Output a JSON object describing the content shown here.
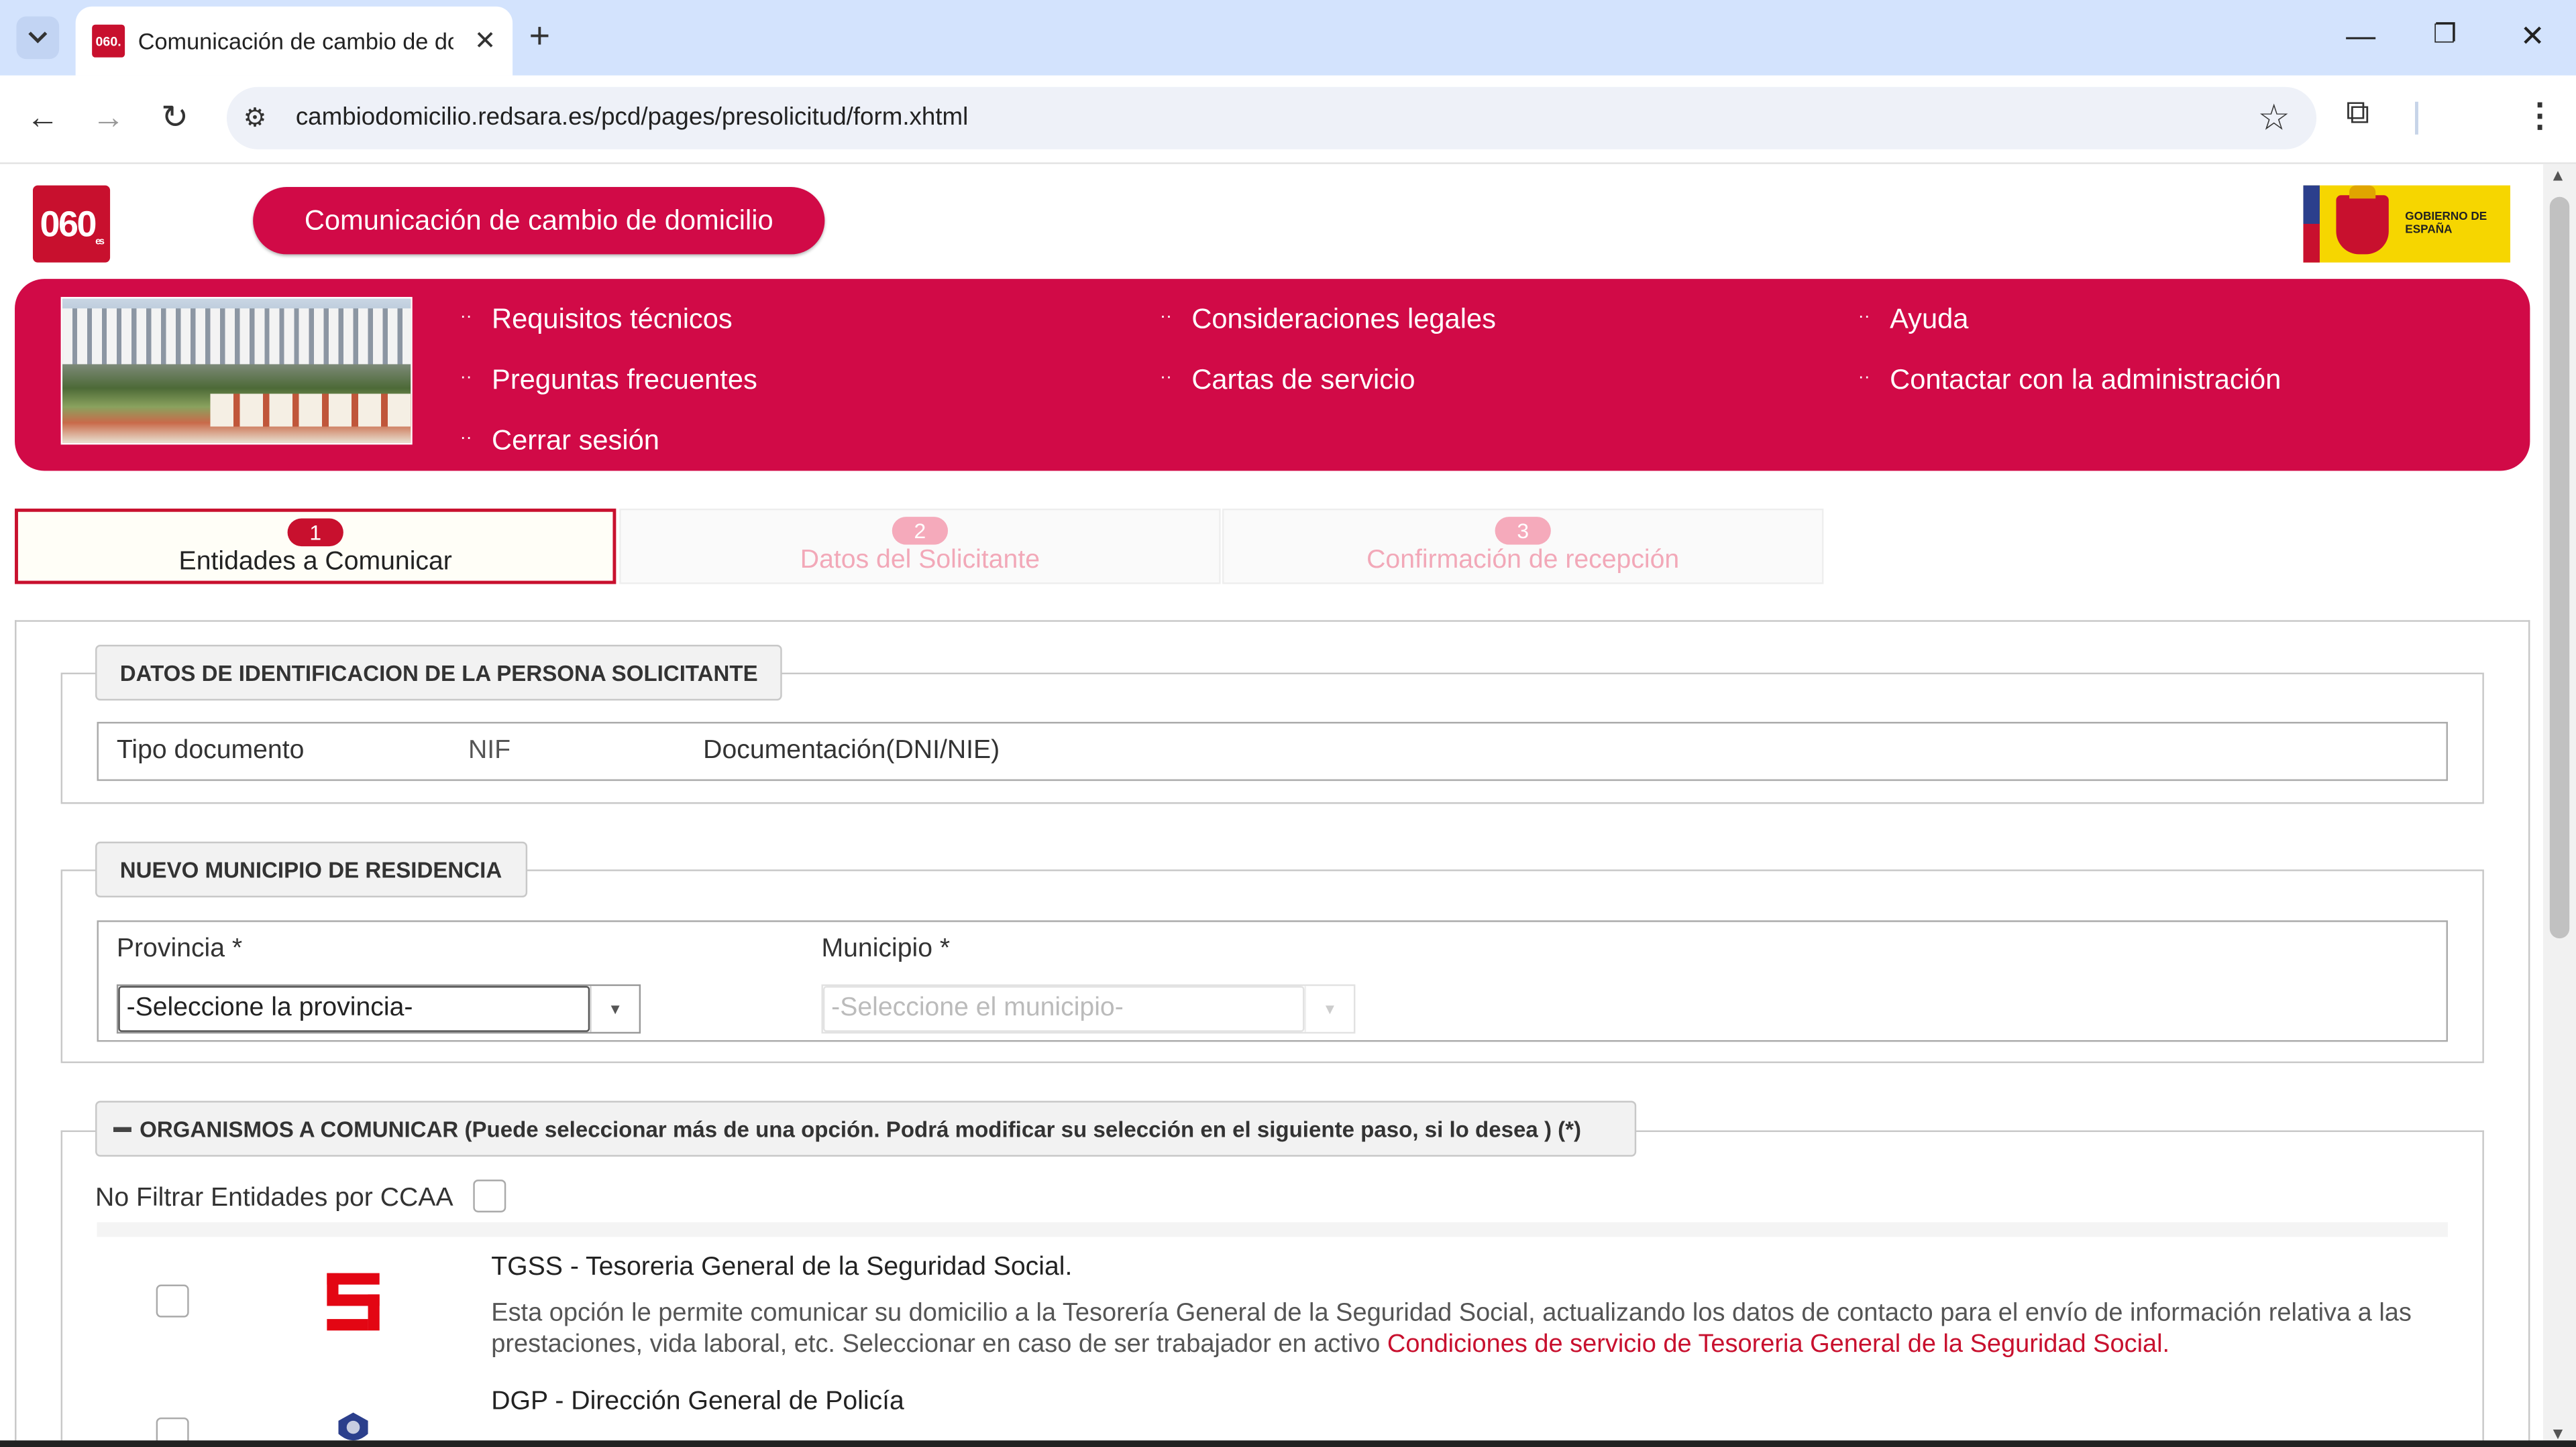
{
  "browser": {
    "tab_title": "Comunicación de cambio de do",
    "favicon_label": "060.",
    "url": "cambiodomicilio.redsara.es/pcd/pages/presolicitud/form.xhtml"
  },
  "header": {
    "logo": "060",
    "logo_suffix": "es",
    "title": "Comunicación de cambio de domicilio",
    "gov_logo_text": "GOBIERNO DE ESPAÑA"
  },
  "nav": {
    "items": [
      {
        "label": "Requisitos técnicos"
      },
      {
        "label": "Consideraciones legales"
      },
      {
        "label": "Ayuda"
      },
      {
        "label": "Preguntas frecuentes"
      },
      {
        "label": "Cartas de servicio"
      },
      {
        "label": "Contactar con la administración"
      },
      {
        "label": "Cerrar sesión"
      }
    ]
  },
  "steps": [
    {
      "num": "1",
      "label": "Entidades a Comunicar",
      "active": true
    },
    {
      "num": "2",
      "label": "Datos del Solicitante",
      "active": false
    },
    {
      "num": "3",
      "label": "Confirmación de recepción",
      "active": false
    }
  ],
  "identificacion": {
    "legend": "DATOS DE IDENTIFICACION DE LA PERSONA SOLICITANTE",
    "tipo_label": "Tipo documento",
    "tipo_value": "NIF",
    "doc_label": "Documentación(DNI/NIE)"
  },
  "municipio": {
    "legend": "NUEVO MUNICIPIO DE RESIDENCIA",
    "provincia_label": "Provincia  *",
    "provincia_value": "-Seleccione la provincia-",
    "municipio_label": "Municipio  *",
    "municipio_value": "-Seleccione el municipio-"
  },
  "organismos": {
    "legend_icon": "minus-icon",
    "legend": "ORGANISMOS A COMUNICAR (Puede seleccionar más de una opción. Podrá modificar su selección en el siguiente paso, si lo desea ) (*)",
    "filter_label": "No Filtrar Entidades por CCAA",
    "items": [
      {
        "title": "TGSS - Tesoreria General de la Seguridad Social.",
        "desc": "Esta opción le permite comunicar su domicilio a la Tesorería General de la Seguridad Social, actualizando los datos de contacto para el envío de información relativa a las prestaciones, vida laboral, etc. Seleccionar en caso de ser trabajador en activo",
        "link": "Condiciones de servicio de Tesoreria General de la Seguridad Social."
      },
      {
        "title": "DGP - Dirección General de Policía",
        "desc": ""
      }
    ]
  },
  "colors": {
    "accent": "#d10a47",
    "brand_red": "#c8102e"
  }
}
